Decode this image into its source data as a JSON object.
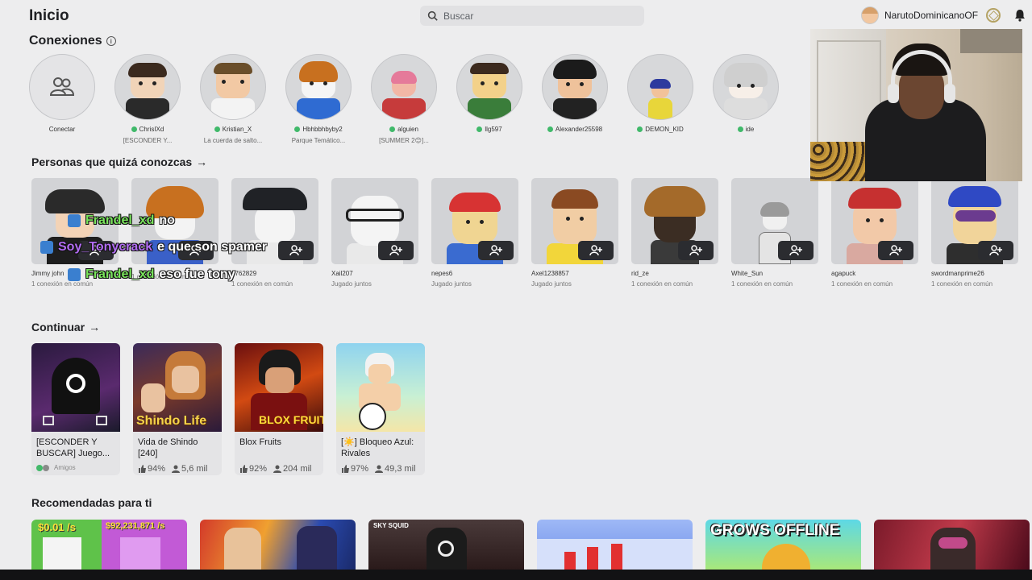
{
  "header": {
    "title": "Inicio",
    "search_placeholder": "Buscar",
    "username": "NarutoDominicanoOF"
  },
  "connections": {
    "title": "Conexiones",
    "items": [
      {
        "name": "Conectar",
        "status": ""
      },
      {
        "name": "ChrisIXd",
        "status": "[ESCONDER Y..."
      },
      {
        "name": "Kristian_X",
        "status": "La cuerda de salto..."
      },
      {
        "name": "Hbhbbhbyby2",
        "status": "Parque Temático..."
      },
      {
        "name": "alguien",
        "status": "[SUMMER 2😊]..."
      },
      {
        "name": "llg597",
        "status": ""
      },
      {
        "name": "Alexander25598",
        "status": ""
      },
      {
        "name": "DEMON_KID",
        "status": ""
      },
      {
        "name": "ide",
        "status": ""
      }
    ]
  },
  "people": {
    "title": "Personas que quizá conozcas",
    "items": [
      {
        "name": "Jimmy john",
        "sub": "1 conexión en común"
      },
      {
        "name": "",
        "sub": "1 conexión en común"
      },
      {
        "name": "6762829",
        "sub": "1 conexión en común"
      },
      {
        "name": "Xail207",
        "sub": "Jugado juntos"
      },
      {
        "name": "nepes6",
        "sub": "Jugado juntos"
      },
      {
        "name": "Axel1238857",
        "sub": "Jugado juntos"
      },
      {
        "name": "rid_ze",
        "sub": "1 conexión en común"
      },
      {
        "name": "White_Sun",
        "sub": "1 conexión en común"
      },
      {
        "name": "agapuck",
        "sub": "1 conexión en común"
      },
      {
        "name": "swordmanprime26",
        "sub": "1 conexión en común"
      }
    ]
  },
  "chat": [
    {
      "user": "Frandel_xd",
      "msg": "no",
      "color": "#79e35c"
    },
    {
      "user": "Soy_Tonycrack",
      "msg": "e que son spamer",
      "color": "#b16cf2"
    },
    {
      "user": "Frandel_xd",
      "msg": "eso fue tony",
      "color": "#79e35c"
    }
  ],
  "continue": {
    "title": "Continuar",
    "games": [
      {
        "title": "[ESCONDER Y BUSCAR] Juego...",
        "meta_type": "friends",
        "friends_label": "Amigos"
      },
      {
        "title": "Vida de Shindo [240]",
        "meta_type": "stats",
        "rating": "94%",
        "players": "5,6 mil",
        "thumb_text": "Shindo Life"
      },
      {
        "title": "Blox Fruits",
        "meta_type": "stats",
        "rating": "92%",
        "players": "204 mil",
        "thumb_text": "BLOX FRUITS"
      },
      {
        "title": "[☀️] Bloqueo Azul: Rivales",
        "meta_type": "stats",
        "rating": "97%",
        "players": "49,3 mil"
      }
    ]
  },
  "recommended": {
    "title": "Recomendadas para ti",
    "items": [
      {
        "label_a": "$0.01 /s",
        "label_b": "$92,231,871 /s"
      },
      {
        "label_a": ""
      },
      {
        "label_a": "SKY SQUID"
      },
      {
        "label_a": ""
      },
      {
        "label_a": "GROWS OFFLINE"
      },
      {
        "label_a": ""
      }
    ]
  },
  "colors": {
    "background": "#ededee",
    "online": "#40b96a",
    "button_dark": "#2b2c30"
  }
}
